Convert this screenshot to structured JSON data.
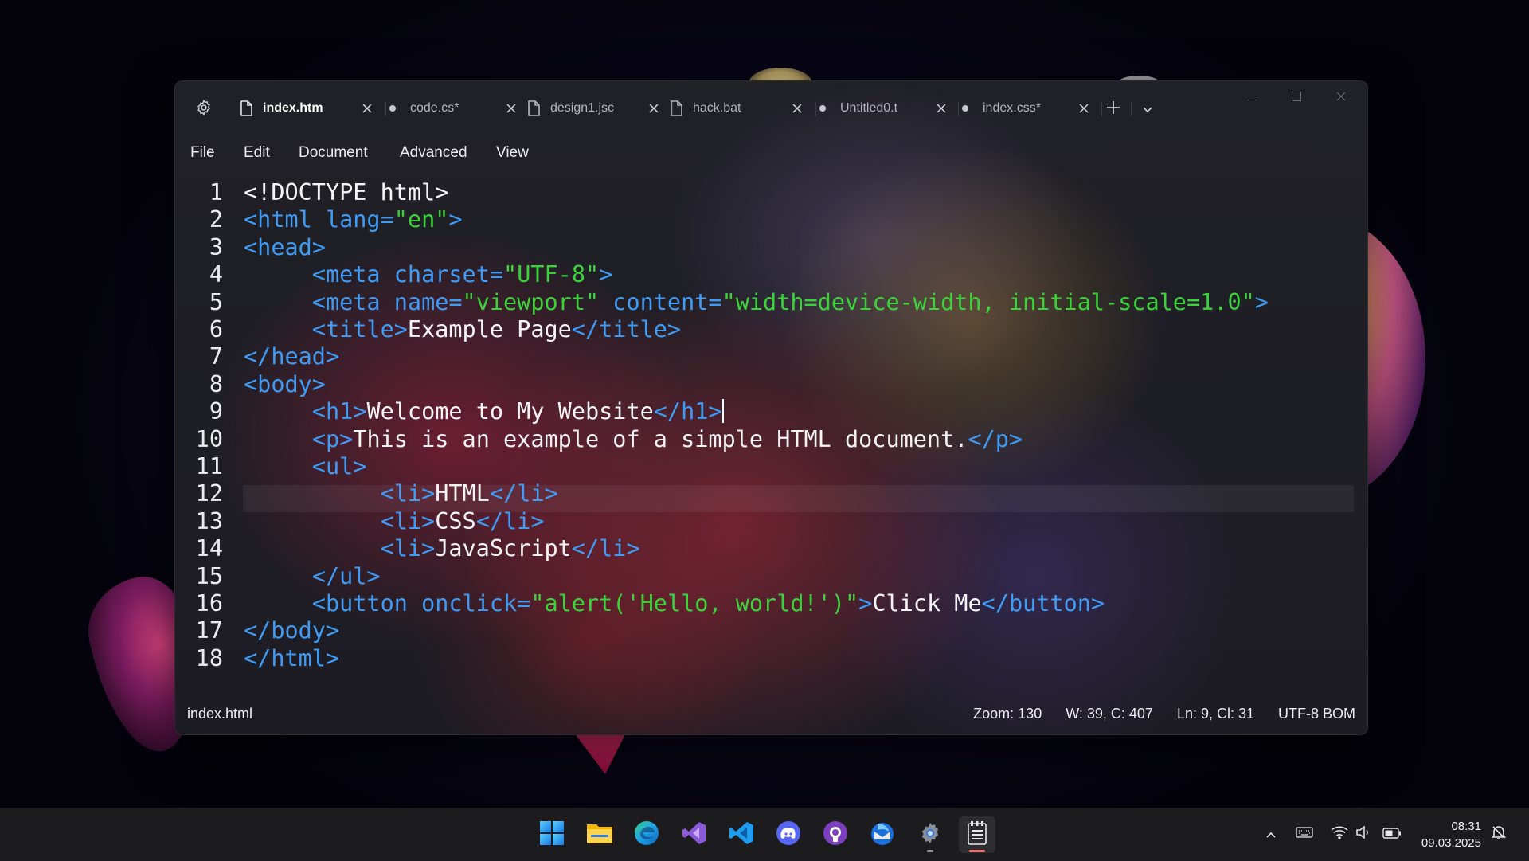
{
  "tabs": [
    {
      "label": "index.htm",
      "icon": "file-icon",
      "active": true,
      "modified": false
    },
    {
      "label": "code.cs*",
      "icon": "unsaved-dot",
      "active": false,
      "modified": true
    },
    {
      "label": "design1.jsc",
      "icon": "file-icon",
      "active": false,
      "modified": false
    },
    {
      "label": "hack.bat",
      "icon": "file-icon",
      "active": false,
      "modified": false
    },
    {
      "label": "Untitled0.t",
      "icon": "unsaved-dot",
      "active": false,
      "modified": true
    },
    {
      "label": "index.css*",
      "icon": "unsaved-dot",
      "active": false,
      "modified": true
    }
  ],
  "menu": [
    "File",
    "Edit",
    "Document",
    "Advanced",
    "View"
  ],
  "editor": {
    "current_line": 9,
    "lines": [
      {
        "num": "1",
        "tokens": [
          {
            "t": "text",
            "v": "<!DOCTYPE html>"
          }
        ]
      },
      {
        "num": "2",
        "tokens": [
          {
            "t": "tag",
            "v": "<html "
          },
          {
            "t": "attr",
            "v": "lang="
          },
          {
            "t": "str",
            "v": "\"en\""
          },
          {
            "t": "tag",
            "v": ">"
          }
        ]
      },
      {
        "num": "3",
        "tokens": [
          {
            "t": "tag",
            "v": "<head>"
          }
        ]
      },
      {
        "num": "4",
        "tokens": [
          {
            "t": "text",
            "v": "     "
          },
          {
            "t": "tag",
            "v": "<meta "
          },
          {
            "t": "attr",
            "v": "charset="
          },
          {
            "t": "str",
            "v": "\"UTF-8\""
          },
          {
            "t": "tag",
            "v": ">"
          }
        ]
      },
      {
        "num": "5",
        "tokens": [
          {
            "t": "text",
            "v": "     "
          },
          {
            "t": "tag",
            "v": "<meta "
          },
          {
            "t": "attr",
            "v": "name="
          },
          {
            "t": "str",
            "v": "\"viewport\""
          },
          {
            "t": "attr",
            "v": " content="
          },
          {
            "t": "str",
            "v": "\"width=device-width, initial-scale=1.0\""
          },
          {
            "t": "tag",
            "v": ">"
          }
        ]
      },
      {
        "num": "6",
        "tokens": [
          {
            "t": "text",
            "v": "     "
          },
          {
            "t": "tag",
            "v": "<title>"
          },
          {
            "t": "text",
            "v": "Example Page"
          },
          {
            "t": "tag",
            "v": "</title>"
          }
        ]
      },
      {
        "num": "7",
        "tokens": [
          {
            "t": "tag",
            "v": "</head>"
          }
        ]
      },
      {
        "num": "8",
        "tokens": [
          {
            "t": "tag",
            "v": "<body>"
          }
        ]
      },
      {
        "num": "9",
        "tokens": [
          {
            "t": "text",
            "v": "     "
          },
          {
            "t": "tag",
            "v": "<h1>"
          },
          {
            "t": "text",
            "v": "Welcome to My Website"
          },
          {
            "t": "tag",
            "v": "</h1>"
          }
        ]
      },
      {
        "num": "10",
        "tokens": [
          {
            "t": "text",
            "v": "     "
          },
          {
            "t": "tag",
            "v": "<p>"
          },
          {
            "t": "text",
            "v": "This is an example of a simple HTML document."
          },
          {
            "t": "tag",
            "v": "</p>"
          }
        ]
      },
      {
        "num": "11",
        "tokens": [
          {
            "t": "text",
            "v": "     "
          },
          {
            "t": "tag",
            "v": "<ul>"
          }
        ]
      },
      {
        "num": "12",
        "tokens": [
          {
            "t": "text",
            "v": "          "
          },
          {
            "t": "tag",
            "v": "<li>"
          },
          {
            "t": "text",
            "v": "HTML"
          },
          {
            "t": "tag",
            "v": "</li>"
          }
        ]
      },
      {
        "num": "13",
        "tokens": [
          {
            "t": "text",
            "v": "          "
          },
          {
            "t": "tag",
            "v": "<li>"
          },
          {
            "t": "text",
            "v": "CSS"
          },
          {
            "t": "tag",
            "v": "</li>"
          }
        ]
      },
      {
        "num": "14",
        "tokens": [
          {
            "t": "text",
            "v": "          "
          },
          {
            "t": "tag",
            "v": "<li>"
          },
          {
            "t": "text",
            "v": "JavaScript"
          },
          {
            "t": "tag",
            "v": "</li>"
          }
        ]
      },
      {
        "num": "15",
        "tokens": [
          {
            "t": "text",
            "v": "     "
          },
          {
            "t": "tag",
            "v": "</ul>"
          }
        ]
      },
      {
        "num": "16",
        "tokens": [
          {
            "t": "text",
            "v": "     "
          },
          {
            "t": "tag",
            "v": "<button "
          },
          {
            "t": "attr",
            "v": "onclick="
          },
          {
            "t": "str",
            "v": "\"alert('Hello, world!')\""
          },
          {
            "t": "tag",
            "v": ">"
          },
          {
            "t": "text",
            "v": "Click Me"
          },
          {
            "t": "tag",
            "v": "</button>"
          }
        ]
      },
      {
        "num": "17",
        "tokens": [
          {
            "t": "tag",
            "v": "</body>"
          }
        ]
      },
      {
        "num": "18",
        "tokens": [
          {
            "t": "tag",
            "v": "</html>"
          }
        ]
      }
    ]
  },
  "status": {
    "filename": "index.html",
    "zoom": "Zoom: 130",
    "counts": "W: 39, C: 407",
    "position": "Ln: 9, Cl: 31",
    "encoding": "UTF-8 BOM"
  },
  "taskbar": {
    "apps": [
      "windows-start-icon",
      "file-explorer-icon",
      "edge-icon",
      "visual-studio-icon",
      "vscode-icon",
      "discord-icon",
      "github-desktop-icon",
      "thunderbird-icon",
      "settings-icon",
      "notepad-icon"
    ],
    "time": "08:31",
    "date": "09.03.2025"
  },
  "colors": {
    "tag": "#3f9bf4",
    "string": "#3ad43a",
    "text": "#f4f4f6",
    "background": "#1c1c22"
  }
}
